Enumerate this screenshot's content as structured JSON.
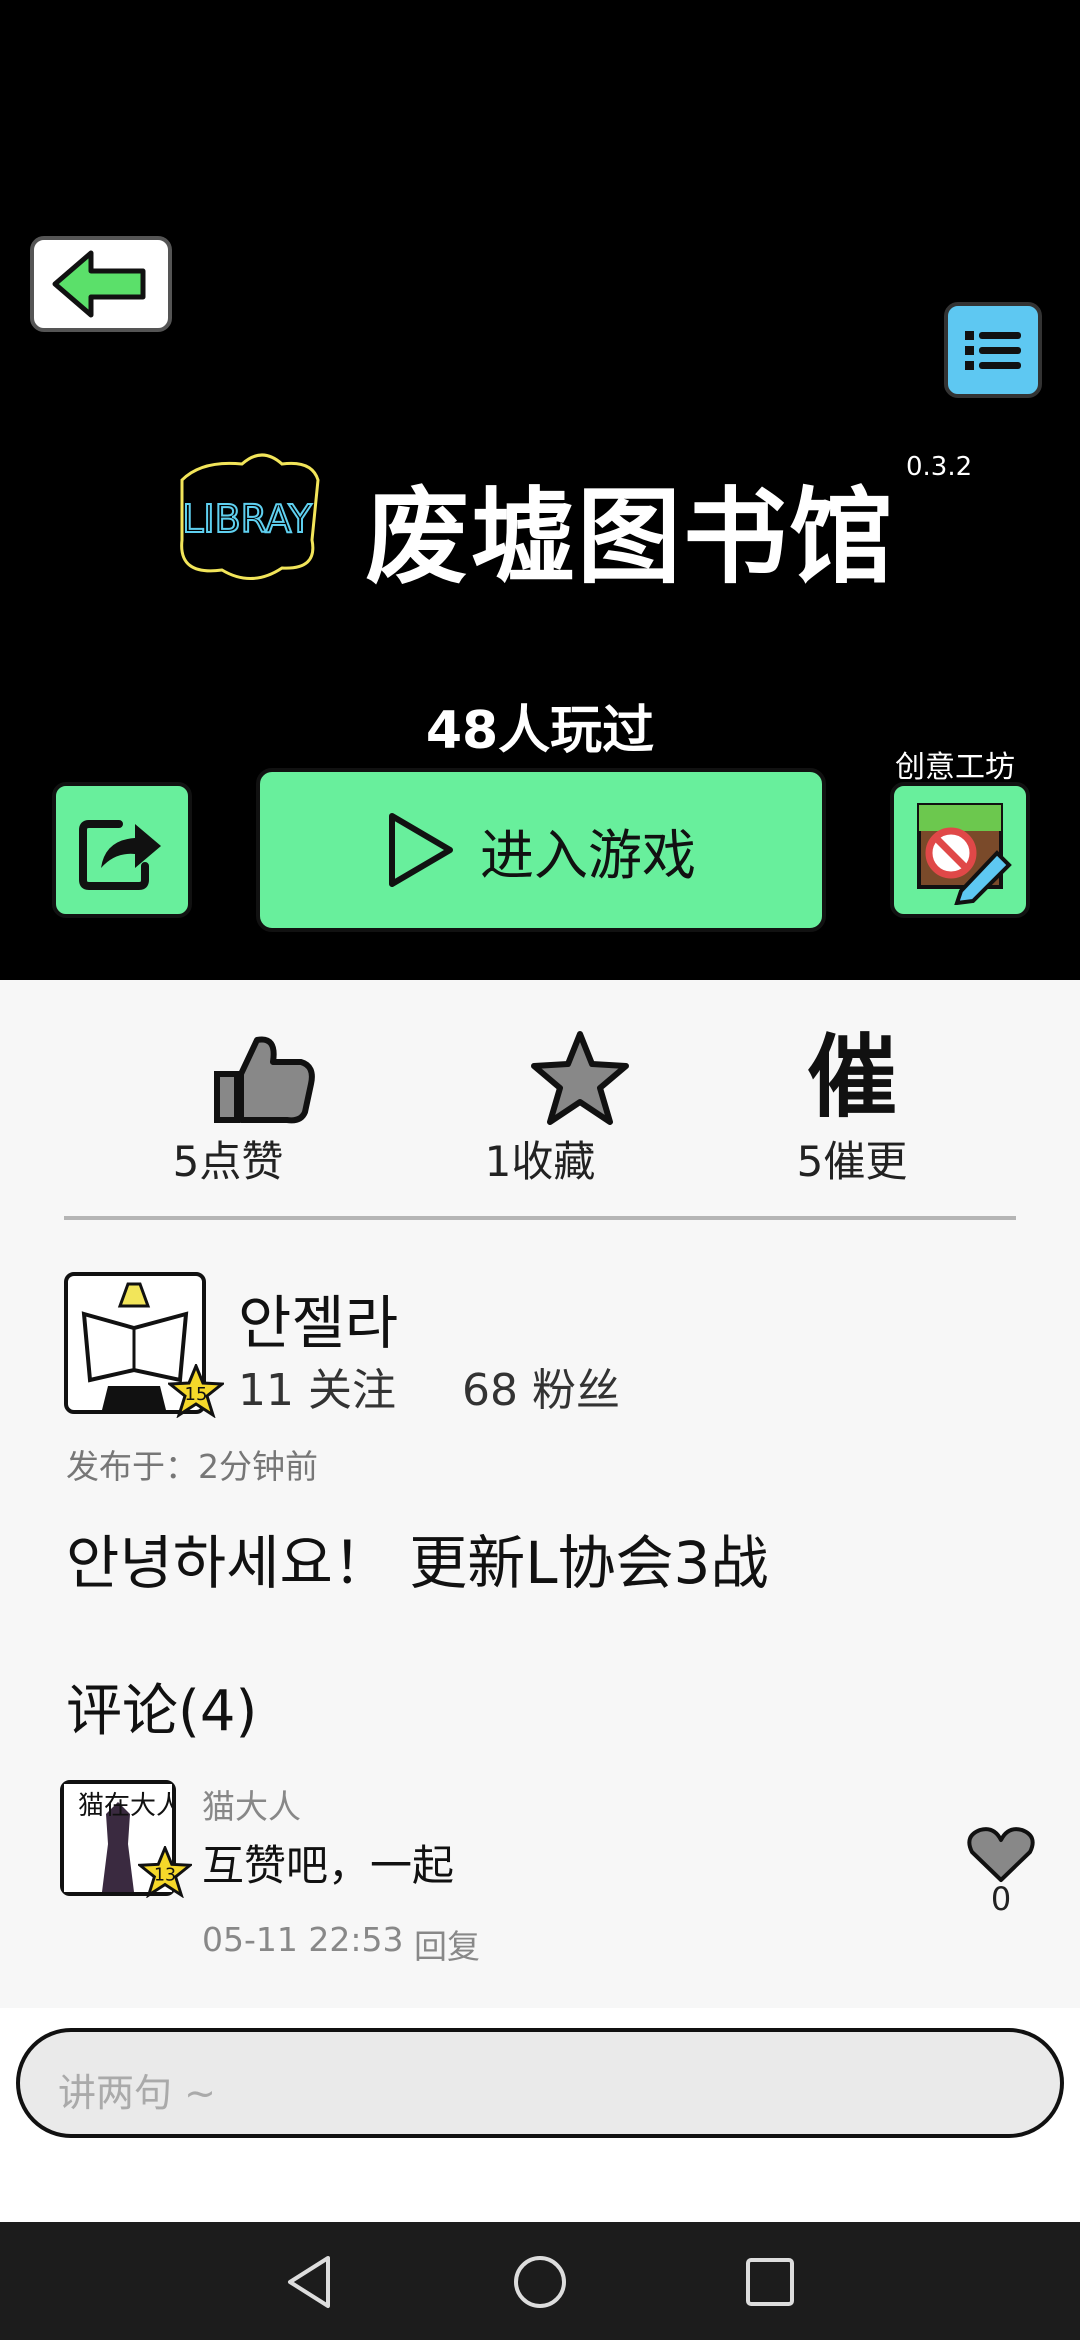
{
  "game": {
    "title": "废墟图书馆",
    "logo_text": "LIBRAY",
    "version": "0.3.2",
    "played_count": "48人玩过",
    "play_button_label": "进入游戏",
    "workshop_label": "创意工坊"
  },
  "stats": {
    "likes": "5点赞",
    "favorites": "1收藏",
    "urge_glyph": "催",
    "urges": "5催更"
  },
  "author": {
    "name": "안젤라",
    "level": "15",
    "follow": "11 关注",
    "fans": "68 粉丝",
    "posted": "发布于：2分钟前",
    "post_text": "안녕하세요！ 更新L协会3战"
  },
  "comments": {
    "title": "评论(4)",
    "items": [
      {
        "user": "猫大人",
        "level": "13",
        "avatar_text": "猫在大人战",
        "text": "互赞吧，一起",
        "time": "05-11 22:53",
        "reply_label": "回复",
        "likes": "0"
      }
    ]
  },
  "input": {
    "placeholder": "讲两句 ~"
  },
  "colors": {
    "accent_green": "#68ef9c",
    "menu_blue": "#5ec8f2",
    "header_bg": "#000000"
  },
  "icons": [
    "back-arrow-icon",
    "menu-list-icon",
    "share-icon",
    "play-icon",
    "workshop-icon",
    "thumb-up-icon",
    "star-icon",
    "heart-icon",
    "nav-back-icon",
    "nav-home-icon",
    "nav-recent-icon"
  ]
}
